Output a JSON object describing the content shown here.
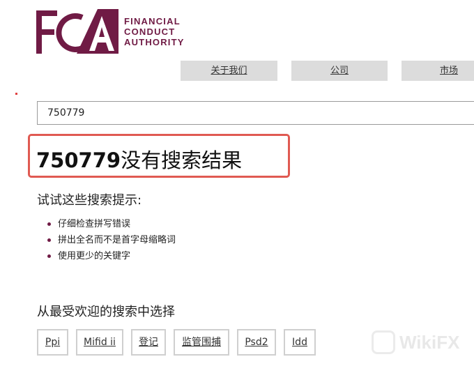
{
  "logo": {
    "mark": "FCA",
    "lines": [
      "FINANCIAL",
      "CONDUCT",
      "AUTHORITY"
    ],
    "color": "#701b45"
  },
  "nav": {
    "items": [
      {
        "label": "关于我们"
      },
      {
        "label": "公司"
      },
      {
        "label": "市场"
      }
    ]
  },
  "search": {
    "value": "750779"
  },
  "result": {
    "query": "750779",
    "suffix": "没有搜索结果",
    "highlight_color": "#e05a52"
  },
  "hints": {
    "heading": "试试这些搜索提示:",
    "items": [
      "仔细检查拼写错误",
      "拼出全名而不是首字母缩略词",
      "使用更少的关键字"
    ]
  },
  "popular": {
    "heading": "从最受欢迎的搜索中选择",
    "chips": [
      "Ppi",
      "Mifid ii",
      "登记",
      "监管围捕",
      "Psd2",
      "Idd"
    ]
  },
  "watermark": {
    "text": "WikiFX"
  }
}
